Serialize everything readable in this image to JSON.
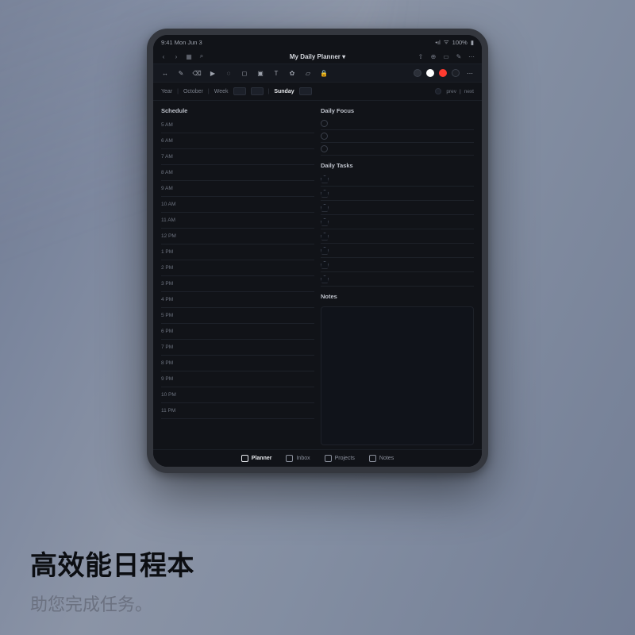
{
  "status": {
    "time": "9:41 Mon Jun 3",
    "network": "•••",
    "wifi": "⌃",
    "battery": "100%"
  },
  "app": {
    "title": "My Daily Planner ▾",
    "leftControls": [
      "chevron-left",
      "chevron-right",
      "grid",
      "search"
    ],
    "rightControls": [
      "share",
      "new",
      "note",
      "edit",
      "more"
    ]
  },
  "toolbar": {
    "tools": [
      "move",
      "pen",
      "eraser",
      "highlighter",
      "lasso",
      "shapes",
      "image",
      "text",
      "stamp",
      "ruler",
      "lock"
    ],
    "swatches": [
      "dark",
      "white",
      "red",
      "dark2"
    ]
  },
  "nav": {
    "year": "Year",
    "month": "October",
    "week": "Week",
    "day": "Sunday",
    "pill_prev": "prev",
    "pill_next": "next"
  },
  "schedule": {
    "title": "Schedule",
    "hours": [
      "5 AM",
      "6 AM",
      "7 AM",
      "8 AM",
      "9 AM",
      "10 AM",
      "11 AM",
      "12 PM",
      "1 PM",
      "2 PM",
      "3 PM",
      "4 PM",
      "5 PM",
      "6 PM",
      "7 PM",
      "8 PM",
      "9 PM",
      "10 PM",
      "11 PM"
    ]
  },
  "focus": {
    "title": "Daily Focus",
    "lines": 3
  },
  "tasks": {
    "title": "Daily Tasks",
    "lines": 8
  },
  "notes": {
    "title": "Notes"
  },
  "bottomnav": {
    "items": [
      {
        "label": "Planner",
        "active": true
      },
      {
        "label": "Inbox",
        "active": false
      },
      {
        "label": "Projects",
        "active": false
      },
      {
        "label": "Notes",
        "active": false
      }
    ]
  },
  "caption": {
    "headline": "高效能日程本",
    "subline": "助您完成任务。"
  }
}
